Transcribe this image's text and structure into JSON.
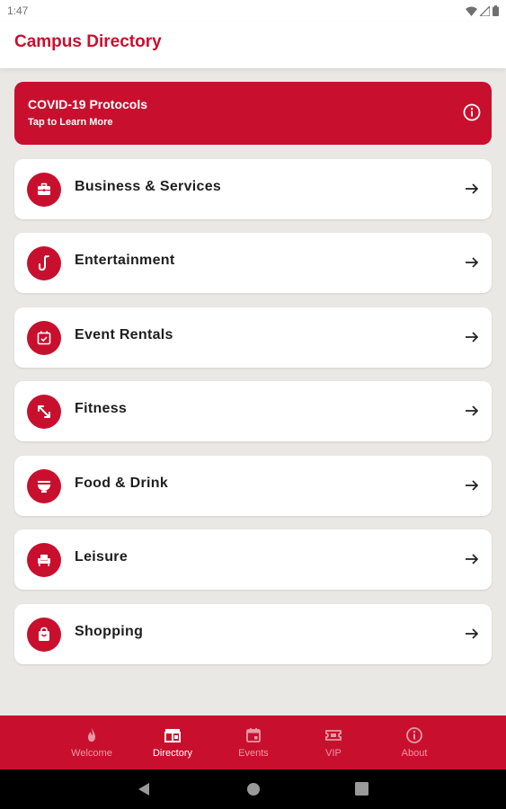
{
  "status": {
    "time": "1:47"
  },
  "app": {
    "title": "Campus Directory"
  },
  "banner": {
    "title": "COVID-19 Protocols",
    "subtitle": "Tap to Learn More"
  },
  "categories": [
    {
      "label": "Business & Services",
      "icon": "briefcase-icon"
    },
    {
      "label": "Entertainment",
      "icon": "saxophone-icon"
    },
    {
      "label": "Event Rentals",
      "icon": "calendar-check-icon"
    },
    {
      "label": "Fitness",
      "icon": "fitness-arrows-icon"
    },
    {
      "label": "Food & Drink",
      "icon": "bowl-icon"
    },
    {
      "label": "Leisure",
      "icon": "armchair-icon"
    },
    {
      "label": "Shopping",
      "icon": "shopping-bag-icon"
    }
  ],
  "nav": {
    "items": [
      {
        "label": "Welcome",
        "icon": "flame-icon"
      },
      {
        "label": "Directory",
        "icon": "directory-icon",
        "active": true
      },
      {
        "label": "Events",
        "icon": "calendar-icon"
      },
      {
        "label": "VIP",
        "icon": "ticket-icon"
      },
      {
        "label": "About",
        "icon": "info-icon"
      }
    ]
  },
  "colors": {
    "accent": "#c8102e",
    "background": "#e9e8e5"
  }
}
